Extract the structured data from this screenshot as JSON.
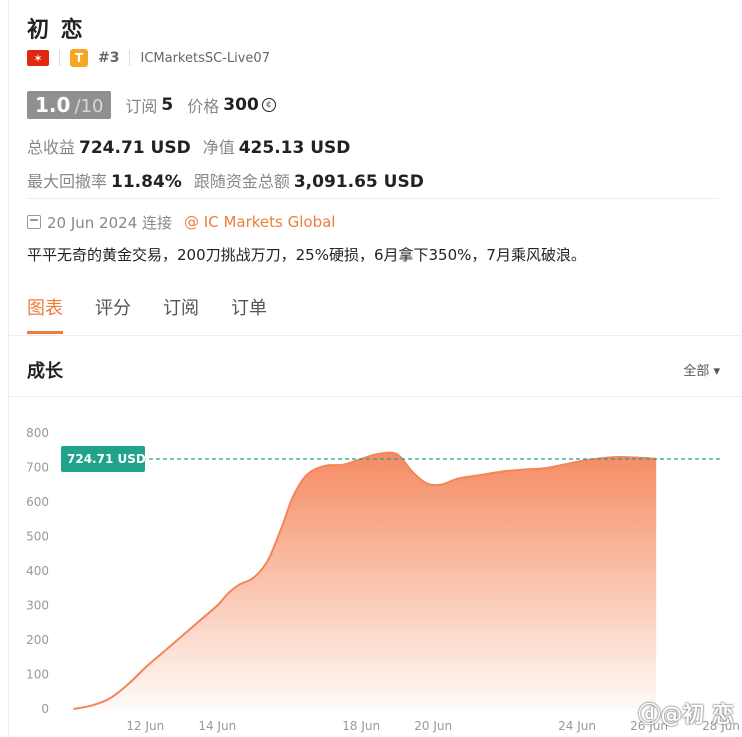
{
  "profile": {
    "name": "初 恋",
    "flag_label": "✶",
    "type_badge": "T",
    "rank": "#3",
    "server": "ICMarketsSC-Live07"
  },
  "rating": {
    "score": "1.0",
    "max": "/10",
    "subscribe_label": "订阅",
    "subscribe_count": "5",
    "price_label": "价格",
    "price_value": "300",
    "coin_symbol": "¢"
  },
  "stats": {
    "total_profit_label": "总收益",
    "total_profit_value": "724.71 USD",
    "equity_label": "净值",
    "equity_value": "425.13 USD",
    "max_drawdown_label": "最大回撤率",
    "max_drawdown_value": "11.84%",
    "follow_funds_label": "跟随资金总额",
    "follow_funds_value": "3,091.65 USD"
  },
  "connection": {
    "date_text": "20 Jun 2024 连接",
    "broker": "@ IC Markets Global"
  },
  "description": "平平无奇的黄金交易，200刀挑战万刀，25%硬损，6月拿下350%，7月乘风破浪。",
  "tabs": [
    {
      "label": "图表"
    },
    {
      "label": "评分"
    },
    {
      "label": "订阅"
    },
    {
      "label": "订单"
    }
  ],
  "growth": {
    "title": "成长",
    "range_label": "全部 ▾"
  },
  "watermark": "ⓓ@初 恋",
  "colors": {
    "accent": "#f07c3b",
    "line": "#f4855a",
    "badge": "#1fa38a"
  },
  "chart_data": {
    "type": "area",
    "ylim": [
      0,
      800
    ],
    "yticks": [
      "0",
      "100",
      "200",
      "300",
      "400",
      "500",
      "600",
      "700",
      "800"
    ],
    "xticks": [
      {
        "label": "12 Jun",
        "x": 12
      },
      {
        "label": "14 Jun",
        "x": 14
      },
      {
        "label": "18 Jun",
        "x": 18
      },
      {
        "label": "20 Jun",
        "x": 20
      },
      {
        "label": "24 Jun",
        "x": 24
      },
      {
        "label": "26 Jun",
        "x": 26
      },
      {
        "label": "28 Jun",
        "x": 28
      }
    ],
    "current_label": "724.71 USD",
    "current_value": 724.71,
    "points": [
      [
        10.0,
        0
      ],
      [
        10.5,
        10
      ],
      [
        11.0,
        30
      ],
      [
        11.5,
        70
      ],
      [
        12.0,
        120
      ],
      [
        12.5,
        165
      ],
      [
        13.0,
        210
      ],
      [
        13.5,
        255
      ],
      [
        14.0,
        300
      ],
      [
        14.3,
        335
      ],
      [
        14.6,
        360
      ],
      [
        15.0,
        380
      ],
      [
        15.4,
        430
      ],
      [
        15.8,
        530
      ],
      [
        16.1,
        615
      ],
      [
        16.5,
        680
      ],
      [
        17.0,
        705
      ],
      [
        17.5,
        708
      ],
      [
        18.0,
        725
      ],
      [
        18.5,
        740
      ],
      [
        19.0,
        738
      ],
      [
        19.4,
        690
      ],
      [
        19.8,
        655
      ],
      [
        20.2,
        650
      ],
      [
        20.7,
        668
      ],
      [
        21.3,
        678
      ],
      [
        21.9,
        688
      ],
      [
        22.5,
        694
      ],
      [
        23.1,
        698
      ],
      [
        23.7,
        710
      ],
      [
        24.3,
        722
      ],
      [
        25.0,
        730
      ],
      [
        25.6,
        729
      ],
      [
        26.2,
        725
      ]
    ]
  }
}
